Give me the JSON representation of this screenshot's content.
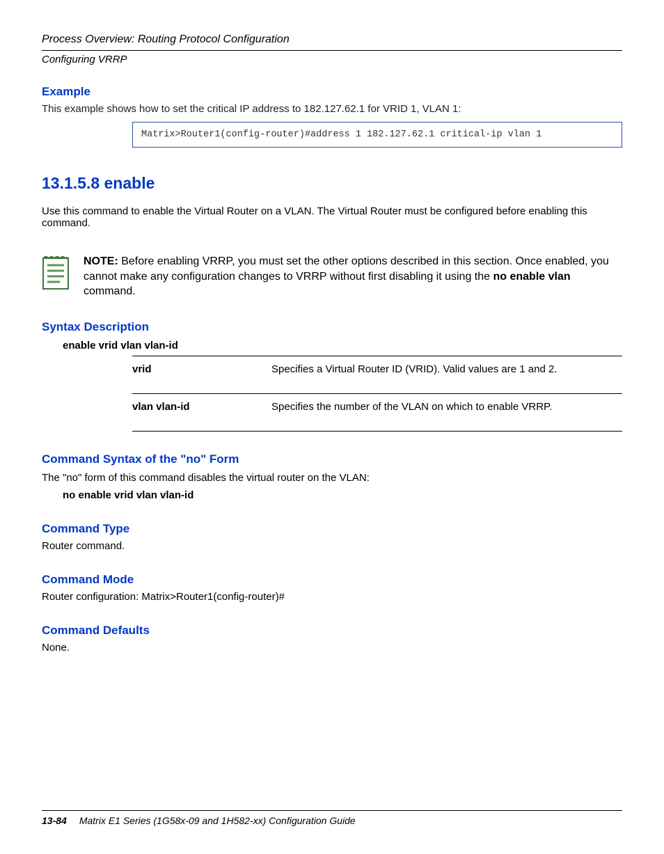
{
  "header": {
    "line1": "Process Overview: Routing Protocol Configuration",
    "line2": "Configuring VRRP"
  },
  "example": {
    "heading": "Example",
    "intro": "This example shows how to set the critical IP address to 182.127.62.1 for VRID 1, VLAN 1:",
    "code": "Matrix>Router1(config-router)#address 1 182.127.62.1 critical-ip vlan 1"
  },
  "section": {
    "heading": "13.1.5.8  enable",
    "body": "Use this command to enable the Virtual Router on a VLAN. The Virtual Router must be configured before enabling this command."
  },
  "note": {
    "label": "NOTE:",
    "text_before": "  Before enabling VRRP, you must set the other options described in this section. Once enabled, you cannot make any configuration changes to VRRP without first disabling it using the ",
    "cmd": "no enable vlan",
    "text_after": " command."
  },
  "syntax": {
    "heading": "Syntax Description",
    "cmd": "enable vrid vlan vlan-id",
    "rows": [
      {
        "key": "vrid",
        "val": "Specifies a Virtual Router ID (VRID). Valid values are 1 and 2."
      },
      {
        "key": "vlan vlan-id",
        "val": "Specifies the number of the VLAN on which to enable VRRP."
      }
    ]
  },
  "noform": {
    "heading": "Command Syntax of the \"no\" Form",
    "text": "The \"no\" form of this command disables the virtual router on the VLAN:",
    "cmd": "no enable vrid vlan vlan-id"
  },
  "cmdtype": {
    "heading": "Command Type",
    "text": "Router command."
  },
  "cmdmode": {
    "heading": "Command Mode",
    "text": "Router configuration: Matrix>Router1(config-router)#"
  },
  "cmddefaults": {
    "heading": "Command Defaults",
    "text": "None."
  },
  "footer": {
    "page": "13-84",
    "title": "Matrix E1 Series (1G58x-09 and 1H582-xx) Configuration Guide"
  }
}
